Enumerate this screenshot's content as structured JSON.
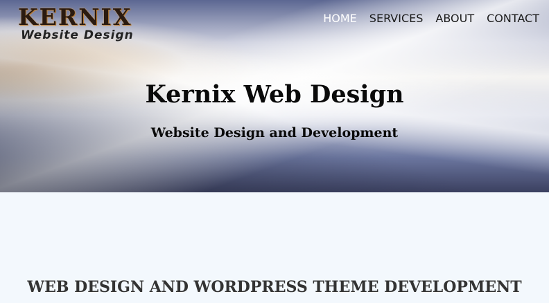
{
  "logo": {
    "main": "KERNIX",
    "sub": "Website Design"
  },
  "nav": {
    "items": [
      {
        "label": "HOME",
        "active": true
      },
      {
        "label": "SERVICES",
        "active": false
      },
      {
        "label": "ABOUT",
        "active": false
      },
      {
        "label": "CONTACT",
        "active": false
      }
    ]
  },
  "hero": {
    "title": "Kernix Web Design",
    "subtitle": "Website Design and Development"
  },
  "main": {
    "section_heading": "WEB DESIGN AND WORDPRESS THEME DEVELOPMENT"
  },
  "colors": {
    "background": "#f3f8fd",
    "nav_active": "#ffffff",
    "nav_text": "#1a1a1a",
    "heading_text": "#333333"
  }
}
